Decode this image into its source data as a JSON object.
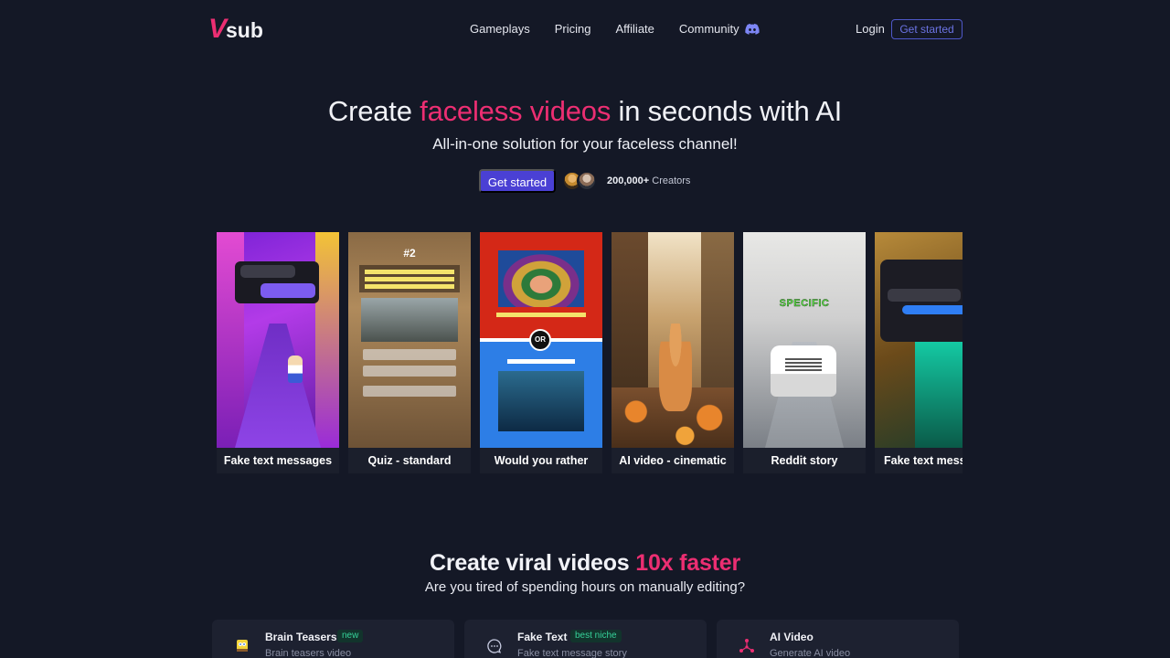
{
  "brand": {
    "logo_v": "V",
    "logo_sub": "sub",
    "accent": "#ec2e72",
    "primary": "#4a40d4"
  },
  "nav": {
    "links": [
      "Gameplays",
      "Pricing",
      "Affiliate",
      "Community"
    ],
    "community_icon": "discord-icon",
    "login": "Login",
    "cta": "Get started"
  },
  "hero": {
    "title_pre": "Create ",
    "title_accent": "faceless videos",
    "title_post": " in seconds with AI",
    "subtitle": "All-in-one solution for your faceless channel!",
    "cta": "Get started",
    "creators_count": "200,000+",
    "creators_label": " Creators"
  },
  "cards": [
    {
      "label": "Fake text messages"
    },
    {
      "label": "Quiz - standard",
      "media_text": "#2"
    },
    {
      "label": "Would you rather",
      "media_text": "OR"
    },
    {
      "label": "AI video - cinematic"
    },
    {
      "label": "Reddit story",
      "media_text": "SPECIFIC"
    },
    {
      "label": "Fake text messages"
    }
  ],
  "section2": {
    "title_pre": "Create viral videos ",
    "title_accent": "10x faster",
    "subtitle": "Are you tired of spending hours on manually editing?"
  },
  "features": [
    {
      "title": "Brain Teasers",
      "badge": "new",
      "desc": "Brain teasers video",
      "icon": "sponge-icon"
    },
    {
      "title": "Fake Text",
      "badge": "best niche",
      "desc": "Fake text message story",
      "icon": "chat-icon"
    },
    {
      "title": "AI Video",
      "badge": "",
      "desc": "Generate AI video",
      "icon": "ai-network-icon"
    }
  ]
}
